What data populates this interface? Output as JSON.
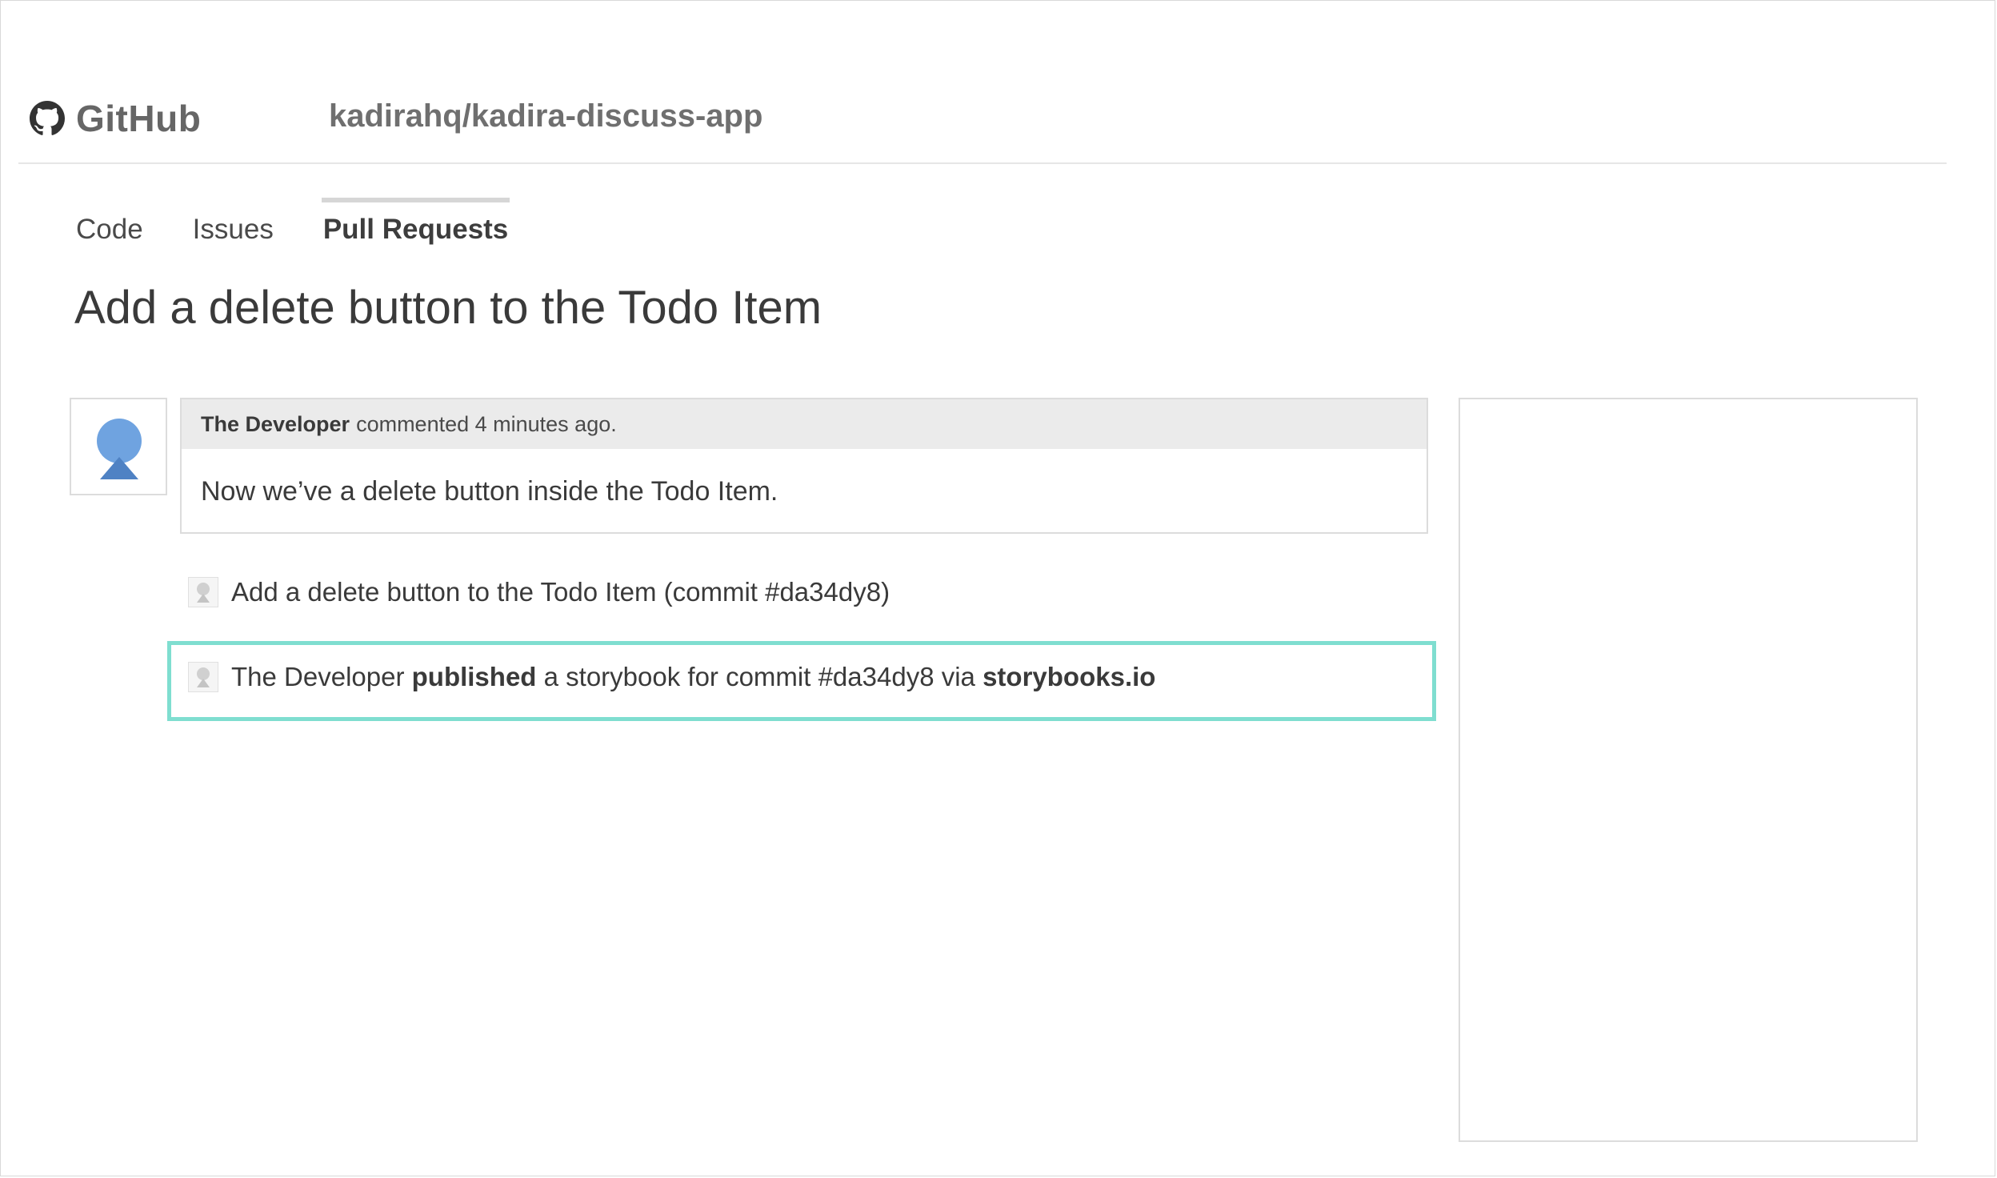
{
  "header": {
    "brand": "GitHub",
    "repo": "kadirahq/kadira-discuss-app"
  },
  "tabs": [
    {
      "label": "Code",
      "active": false
    },
    {
      "label": "Issues",
      "active": false
    },
    {
      "label": "Pull Requests",
      "active": true
    }
  ],
  "pull_request": {
    "title": "Add a delete button to the Todo Item",
    "comment": {
      "author": "The Developer",
      "meta": "commented 4 minutes ago.",
      "body": "Now we’ve a delete button inside the Todo Item."
    },
    "events": [
      {
        "text": "Add a delete button to the Todo Item (commit #da34dy8)"
      },
      {
        "actor": "The Developer",
        "action": "published",
        "middle": "a storybook for commit #da34dy8 via",
        "link": "storybooks.io"
      }
    ]
  },
  "colors": {
    "highlight_border": "#7fded0",
    "avatar_blue": "#6fa3e0",
    "avatar_blue_dark": "#4f82c4"
  },
  "icons": {
    "brand": "github-octocat-icon",
    "avatar": "user-avatar-icon",
    "event": "user-small-icon"
  }
}
